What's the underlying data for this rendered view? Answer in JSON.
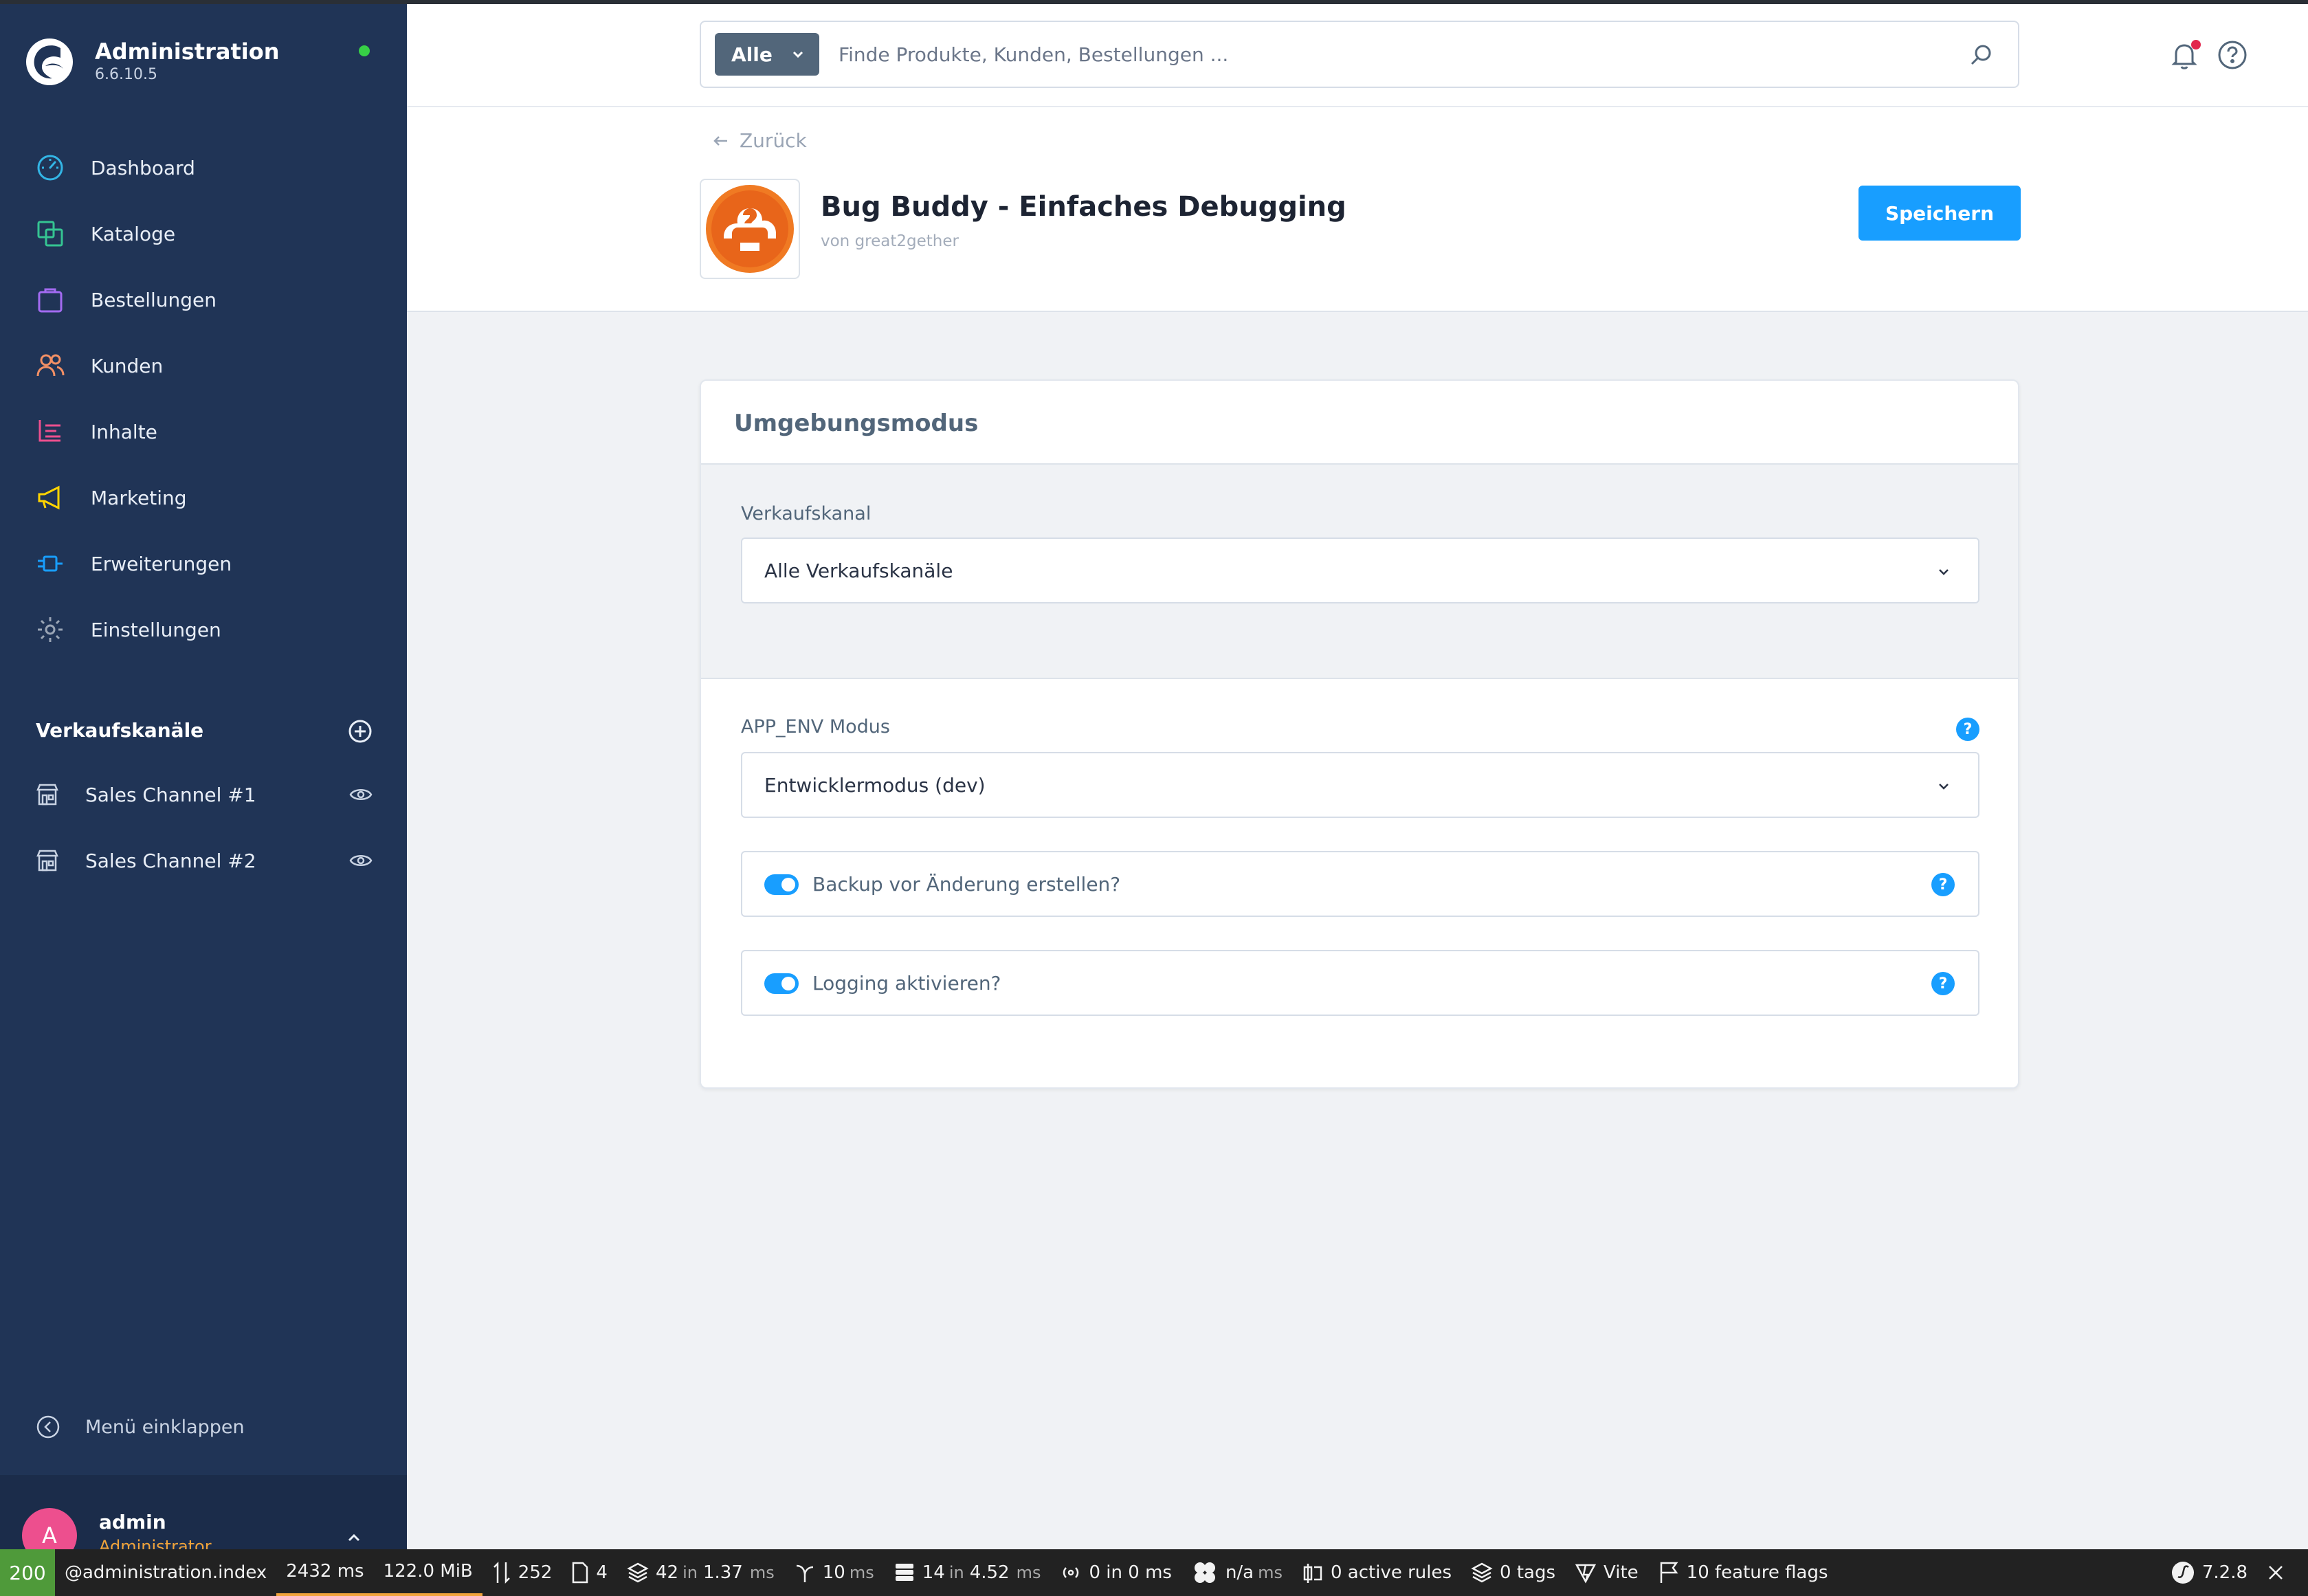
{
  "app": {
    "title": "Administration",
    "version": "6.6.10.5"
  },
  "sidebar": {
    "items": [
      {
        "label": "Dashboard",
        "icon": "dashboard-icon",
        "color": "#33b5e5"
      },
      {
        "label": "Kataloge",
        "icon": "catalog-icon",
        "color": "#35c492"
      },
      {
        "label": "Bestellungen",
        "icon": "orders-icon",
        "color": "#a36bf2"
      },
      {
        "label": "Kunden",
        "icon": "customers-icon",
        "color": "#f39065"
      },
      {
        "label": "Inhalte",
        "icon": "content-icon",
        "color": "#ed4f8e"
      },
      {
        "label": "Marketing",
        "icon": "marketing-icon",
        "color": "#ffd400"
      },
      {
        "label": "Erweiterungen",
        "icon": "extensions-icon",
        "color": "#189eff"
      },
      {
        "label": "Einstellungen",
        "icon": "settings-icon",
        "color": "#9aa5b5"
      }
    ],
    "sales_channels": {
      "title": "Verkaufskanäle",
      "items": [
        {
          "label": "Sales Channel #1"
        },
        {
          "label": "Sales Channel #2"
        }
      ]
    },
    "collapse_label": "Menü einklappen",
    "user": {
      "initial": "A",
      "name": "admin",
      "role": "Administrator"
    }
  },
  "search": {
    "type_label": "Alle",
    "placeholder": "Finde Produkte, Kunden, Bestellungen ..."
  },
  "page": {
    "back_label": "Zurück",
    "title": "Bug Buddy - Einfaches Debugging",
    "author": "von great2gether",
    "save_label": "Speichern"
  },
  "card": {
    "title": "Umgebungsmodus",
    "sales_channel_label": "Verkaufskanal",
    "sales_channel_value": "Alle Verkaufskanäle",
    "app_env_label": "APP_ENV Modus",
    "app_env_value": "Entwicklermodus (dev)",
    "toggles": [
      {
        "label": "Backup vor Änderung erstellen?",
        "enabled": true
      },
      {
        "label": "Logging aktivieren?",
        "enabled": true
      }
    ],
    "help_glyph": "?"
  },
  "debug_toolbar": {
    "status": "200",
    "route": "@administration.index",
    "time": "2432 ms",
    "memory": "122.0 MiB",
    "requests": "252",
    "files": "4",
    "cache_count": "42",
    "cache_in": "in",
    "cache_time": "1.37",
    "cache_unit": "ms",
    "events": "10",
    "events_unit": "ms",
    "db_count": "14",
    "db_in": "in",
    "db_time": "4.52",
    "db_unit": "ms",
    "http": "0 in 0 ms",
    "twig": "n/a",
    "twig_unit": "ms",
    "rules": "0 active rules",
    "tags": "0 tags",
    "vite": "Vite",
    "flags": "10 feature flags",
    "symfony_version": "7.2.8"
  },
  "colors": {
    "sidebar_bg": "#203456",
    "accent": "#189eff",
    "status_online": "#37d046",
    "notification": "#e2264d"
  }
}
